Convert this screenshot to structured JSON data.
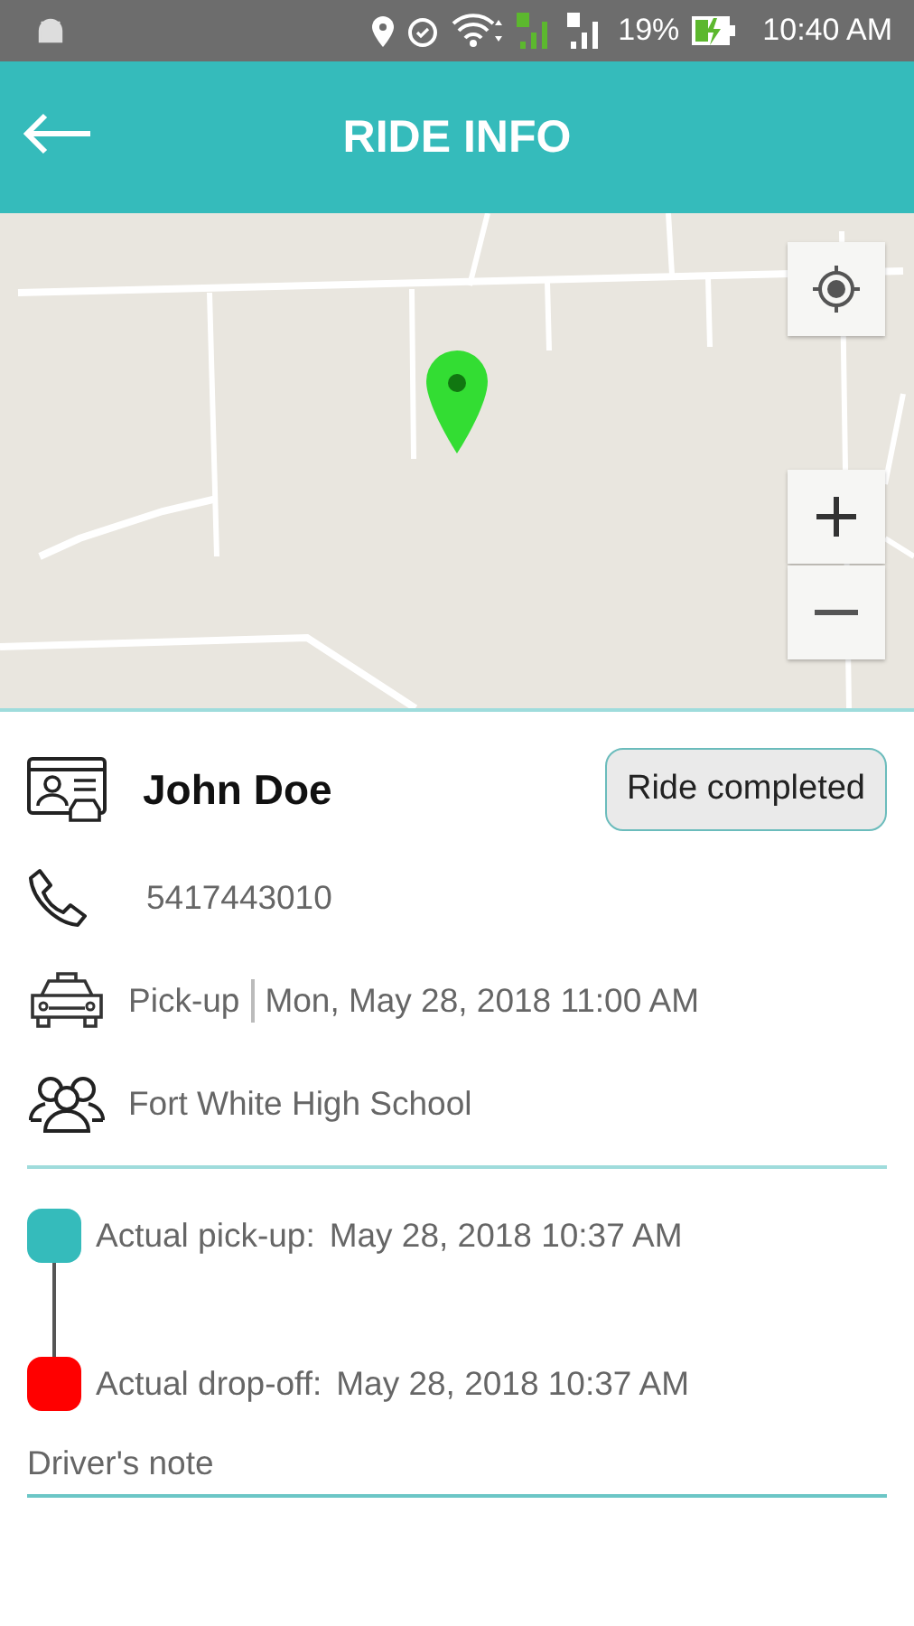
{
  "status_bar": {
    "battery": "19%",
    "time": "10:40 AM"
  },
  "header": {
    "title": "RIDE INFO"
  },
  "rider": {
    "name": "John Doe",
    "status": "Ride completed",
    "phone": "5417443010",
    "pickup_label": "Pick-up",
    "pickup_time": "Mon, May 28, 2018 11:00 AM",
    "school": "Fort White High School"
  },
  "timeline": [
    {
      "label": "Actual pick-up:",
      "time": "May 28, 2018 10:37 AM",
      "color": "#35bbbb"
    },
    {
      "label": "Actual drop-off:",
      "time": "May 28, 2018 10:37 AM",
      "color": "#ff0000"
    }
  ],
  "note": {
    "placeholder": "Driver's note"
  }
}
